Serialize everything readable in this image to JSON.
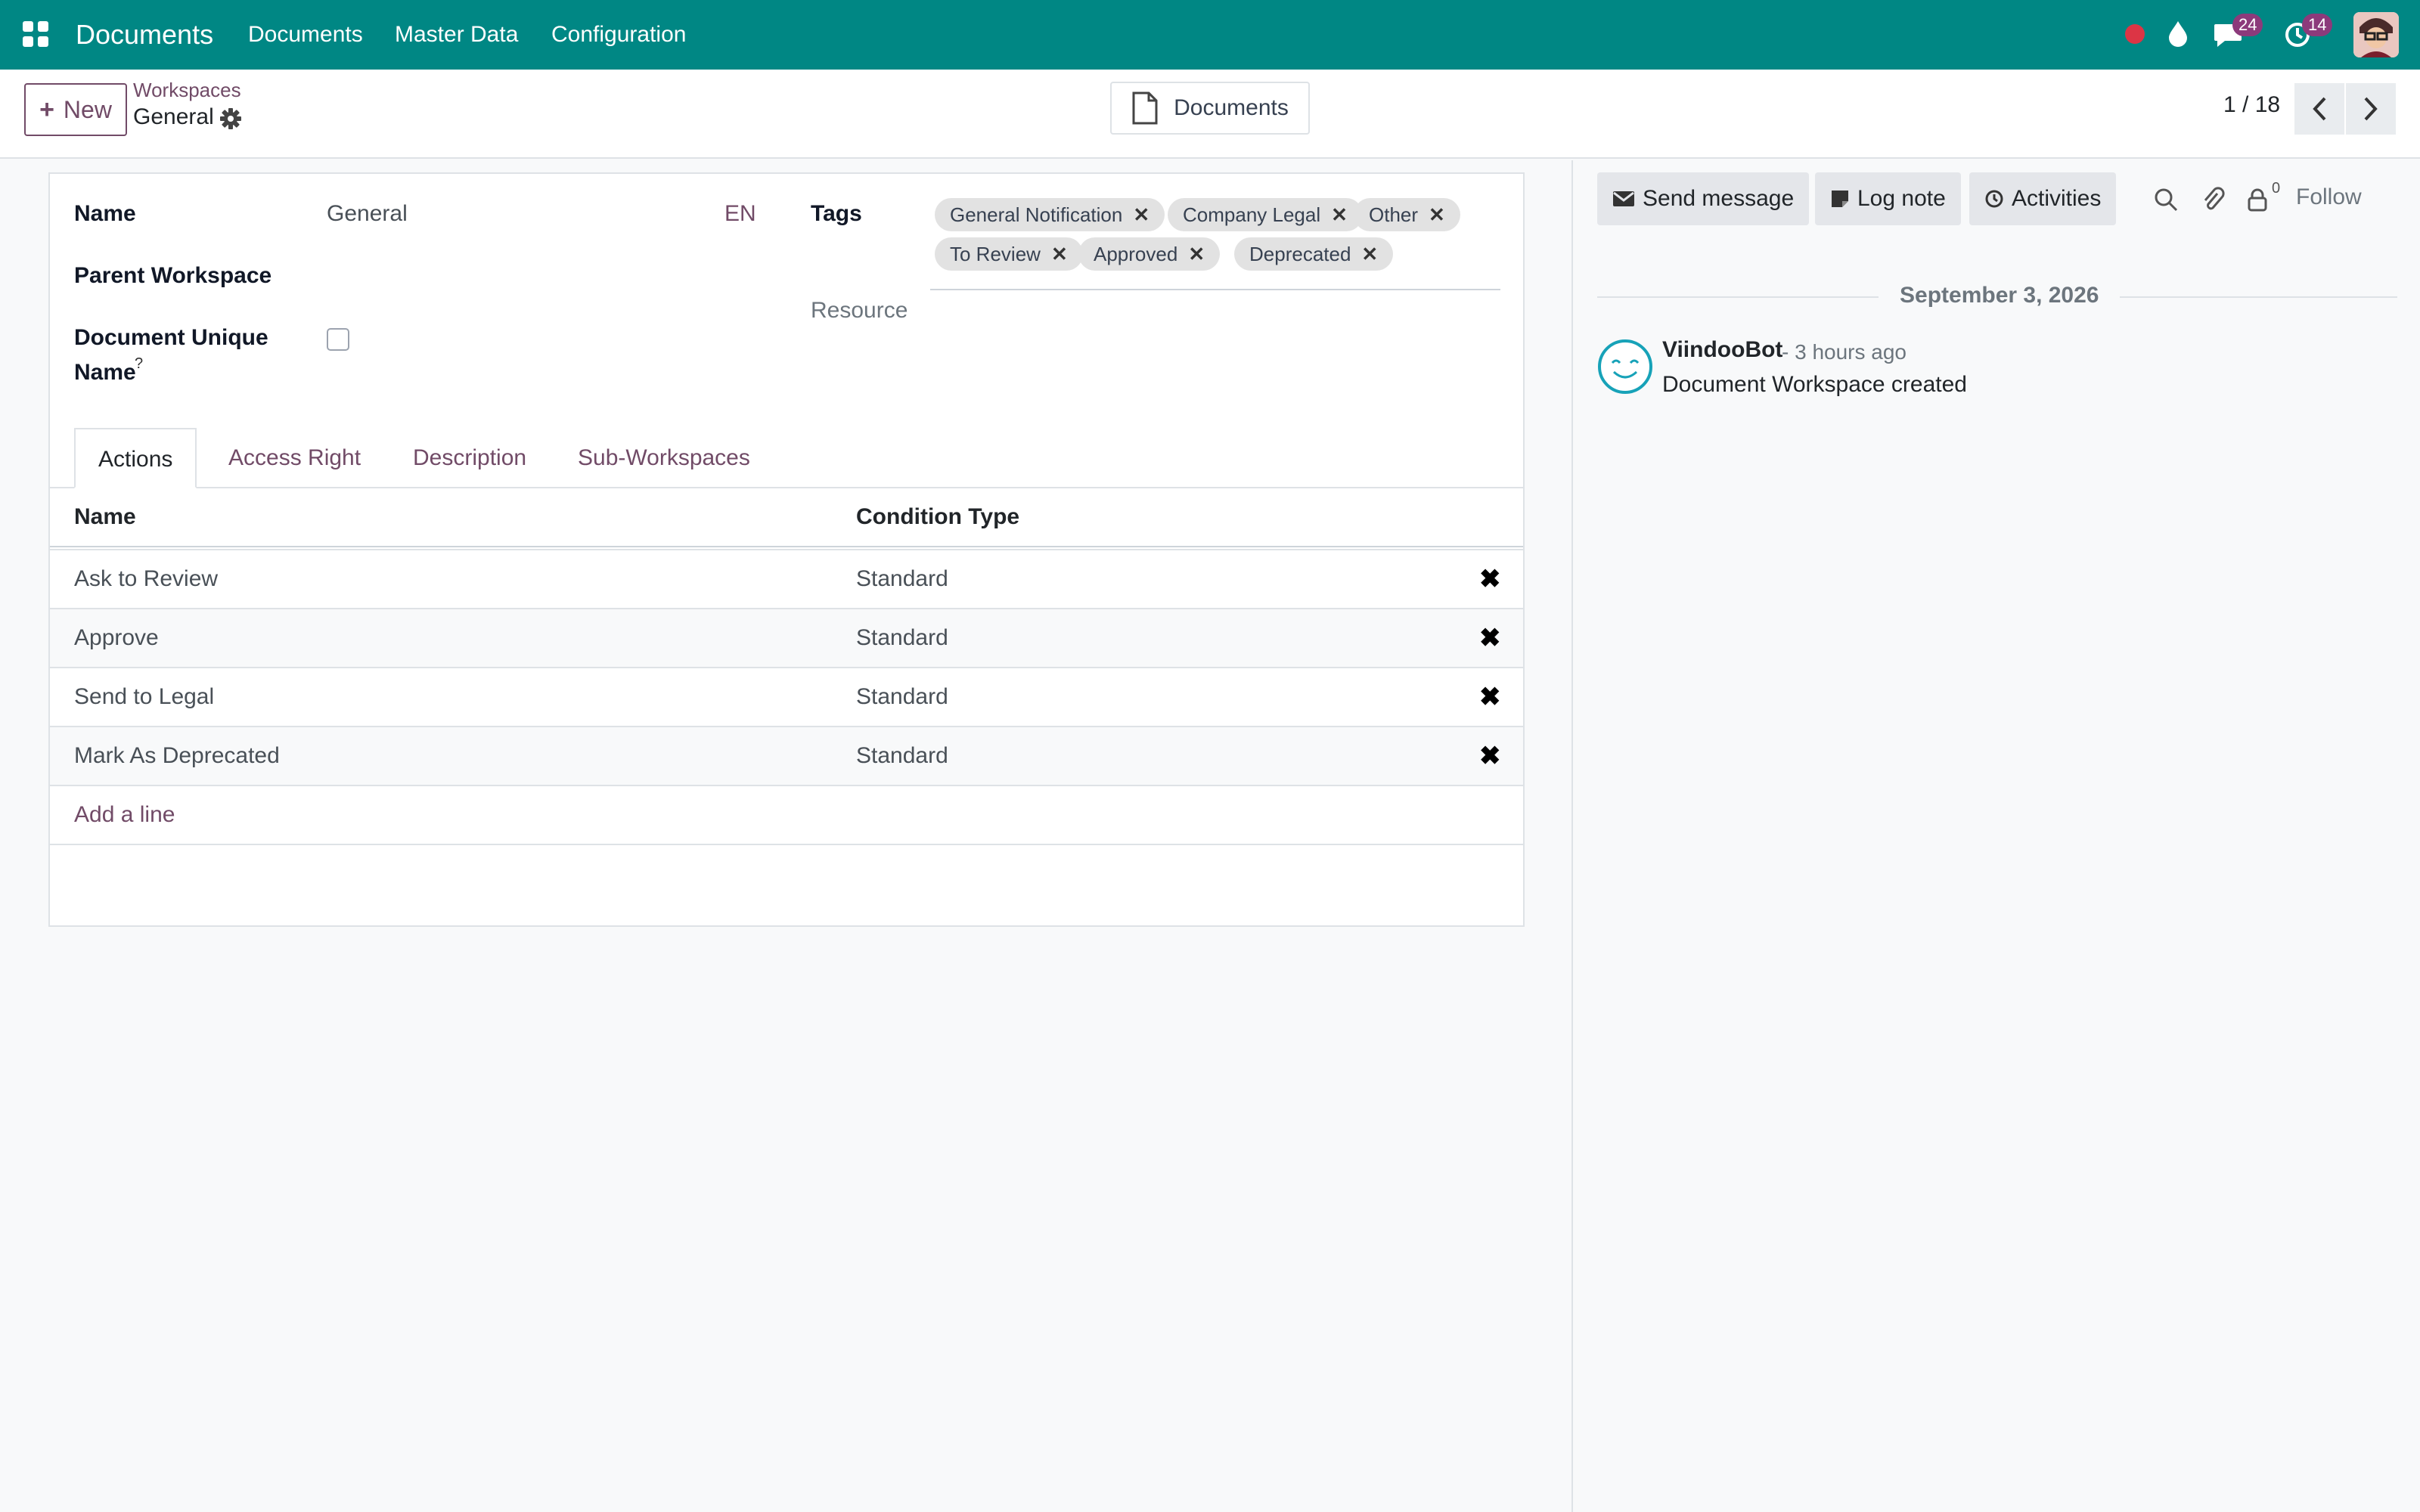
{
  "navbar": {
    "app_title": "Documents",
    "menu": [
      "Documents",
      "Master Data",
      "Configuration"
    ],
    "messages_count": "24",
    "activities_count": "14"
  },
  "control_panel": {
    "new_label": "New",
    "breadcrumb_parent": "Workspaces",
    "breadcrumb_current": "General",
    "documents_button": "Documents",
    "pager": "1 / 18"
  },
  "form": {
    "name_label": "Name",
    "name_value": "General",
    "lang": "EN",
    "parent_label": "Parent Workspace",
    "unique_label_1": "Document Unique",
    "unique_label_2": "Name",
    "unique_help": "?",
    "unique_checked": false,
    "tags_label": "Tags",
    "tags": [
      "General Notification",
      "Company Legal",
      "Other",
      "To Review",
      "Approved",
      "Deprecated"
    ],
    "tag_remove_glyph": "✕",
    "resource_placeholder": "Resource"
  },
  "tabs": [
    "Actions",
    "Access Right",
    "Description",
    "Sub-Workspaces"
  ],
  "table": {
    "headers": [
      "Name",
      "Condition Type"
    ],
    "rows": [
      {
        "name": "Ask to Review",
        "condition": "Standard"
      },
      {
        "name": "Approve",
        "condition": "Standard"
      },
      {
        "name": "Send to Legal",
        "condition": "Standard"
      },
      {
        "name": "Mark As Deprecated",
        "condition": "Standard"
      }
    ],
    "delete_glyph": "✖",
    "add_line": "Add a line"
  },
  "chatter": {
    "send_message": "Send message",
    "log_note": "Log note",
    "activities": "Activities",
    "followers_count": "0",
    "follow": "Follow",
    "date": "September 3, 2026",
    "author": "ViindooBot",
    "time": "- 3 hours ago",
    "message": "Document Workspace created"
  },
  "colors": {
    "navbar": "#008784",
    "brand": "#714b67",
    "badge": "#8c3a7b",
    "avatar_ring": "#17a2b8",
    "status_dot": "#dc3545"
  },
  "icons": [
    "apps-icon",
    "status-dot-icon",
    "drop-icon",
    "chat-icon",
    "clock-icon",
    "plus-icon",
    "gear-icon",
    "document-icon",
    "chevron-left-icon",
    "chevron-right-icon",
    "envelope-icon",
    "note-icon",
    "clock-icon",
    "search-icon",
    "paperclip-icon",
    "user-icon",
    "bot-avatar-icon"
  ]
}
